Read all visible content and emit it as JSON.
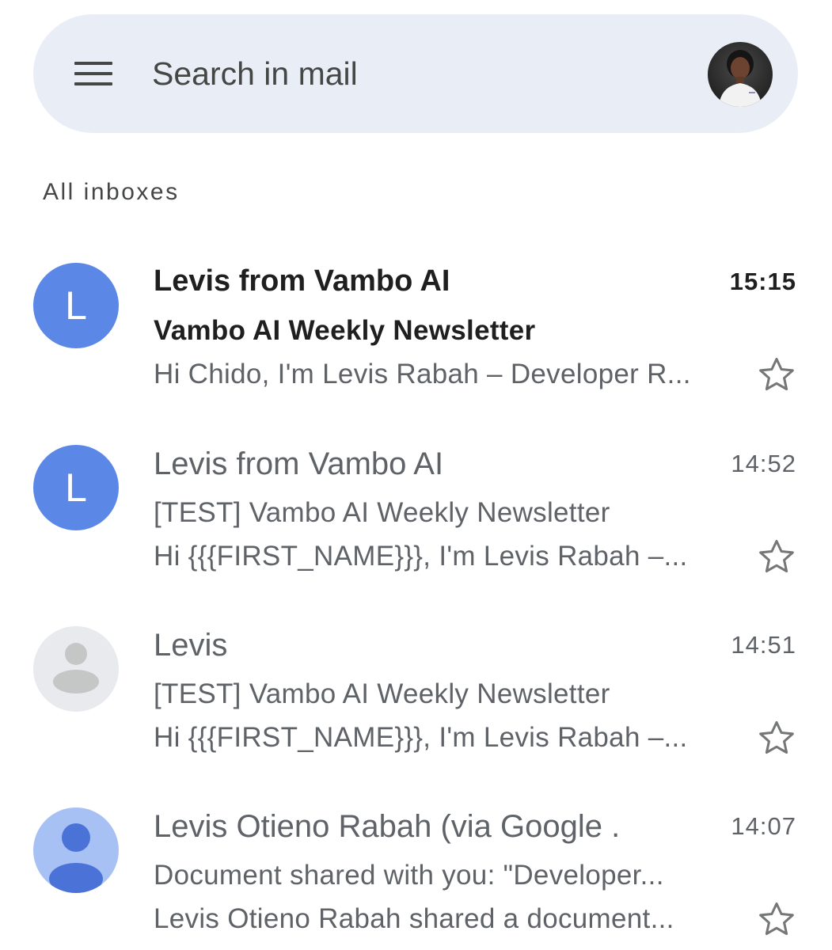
{
  "search": {
    "placeholder": "Search in mail"
  },
  "section": {
    "label": "All inboxes"
  },
  "colors": {
    "search_bar_bg": "#e9eef6",
    "avatar_blue": "#5b87e7",
    "avatar_gray_bg": "#e8eaed",
    "avatar_person_light_blue": "#a7c1f5",
    "avatar_person_dark_blue": "#4b72d6",
    "unread_text": "#1f1f1f",
    "read_text": "#5f6368",
    "star_outline": "#747775"
  },
  "emails": [
    {
      "sender": "Levis from Vambo AI",
      "time": "15:15",
      "subject": "Vambo AI Weekly Newsletter",
      "snippet": "Hi Chido, I'm Levis Rabah – Developer R...",
      "unread": true,
      "avatar_letter": "L",
      "avatar_type": "letter",
      "starred": false
    },
    {
      "sender": "Levis from Vambo AI",
      "time": "14:52",
      "subject": "[TEST] Vambo AI Weekly Newsletter",
      "snippet": "Hi {{{FIRST_NAME}}}, I'm Levis Rabah –...",
      "unread": false,
      "avatar_letter": "L",
      "avatar_type": "letter",
      "starred": false
    },
    {
      "sender": "Levis",
      "time": "14:51",
      "subject": "[TEST] Vambo AI Weekly Newsletter",
      "snippet": "Hi {{{FIRST_NAME}}}, I'm Levis Rabah –...",
      "unread": false,
      "avatar_type": "default-person-gray",
      "starred": false
    },
    {
      "sender": "Levis Otieno Rabah (via Google .",
      "time": "14:07",
      "subject": "Document shared with you: \"Developer...",
      "snippet": "Levis Otieno Rabah shared a document...",
      "unread": false,
      "avatar_type": "default-person-blue",
      "starred": false
    }
  ]
}
